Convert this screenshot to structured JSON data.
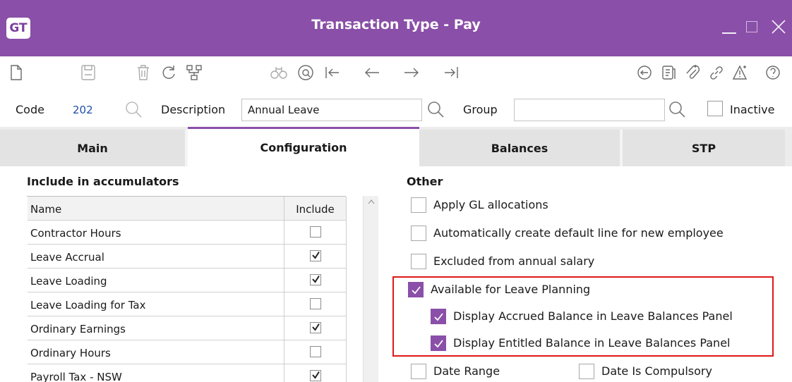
{
  "window": {
    "logo": "GT",
    "title": "Transaction Type - Pay"
  },
  "toolbar": {
    "icons": [
      "new-icon",
      "save-icon",
      "delete-icon",
      "refresh-icon",
      "hierarchy-icon",
      "find-icon",
      "lookup-icon",
      "first-icon",
      "previous-icon",
      "next-icon",
      "last-icon",
      "back-icon",
      "notes-icon",
      "attach-icon",
      "link-icon",
      "alerts-icon",
      "help-icon"
    ]
  },
  "header": {
    "code_label": "Code",
    "code_value": "202",
    "description_label": "Description",
    "description_value": "Annual Leave",
    "group_label": "Group",
    "group_value": "",
    "inactive_label": "Inactive",
    "inactive_checked": false
  },
  "tabs": [
    {
      "label": "Main",
      "active": false
    },
    {
      "label": "Configuration",
      "active": true
    },
    {
      "label": "Balances",
      "active": false
    },
    {
      "label": "STP",
      "active": false
    }
  ],
  "accumulators": {
    "title": "Include in accumulators",
    "columns": [
      "Name",
      "Include"
    ],
    "rows": [
      {
        "name": "Contractor Hours",
        "include": false
      },
      {
        "name": "Leave Accrual",
        "include": true
      },
      {
        "name": "Leave Loading",
        "include": true
      },
      {
        "name": "Leave Loading for Tax",
        "include": false
      },
      {
        "name": "Ordinary Earnings",
        "include": true
      },
      {
        "name": "Ordinary Hours",
        "include": false
      },
      {
        "name": "Payroll Tax - NSW",
        "include": true
      }
    ]
  },
  "other": {
    "title": "Other",
    "options": [
      {
        "label": "Apply GL allocations",
        "checked": false
      },
      {
        "label": "Automatically create default line for new employee",
        "checked": false
      },
      {
        "label": "Excluded from annual salary",
        "checked": false
      },
      {
        "label": "Available for Leave Planning",
        "checked": true
      },
      {
        "label": "Display Accrued Balance in Leave Balances Panel",
        "checked": true
      },
      {
        "label": "Display Entitled Balance in Leave Balances Panel",
        "checked": true
      },
      {
        "label": "Date Range",
        "checked": false
      },
      {
        "label": "Date Is Compulsory",
        "checked": false
      }
    ]
  },
  "colors": {
    "accent": "#8a4fa8",
    "highlight": "#e01818"
  }
}
